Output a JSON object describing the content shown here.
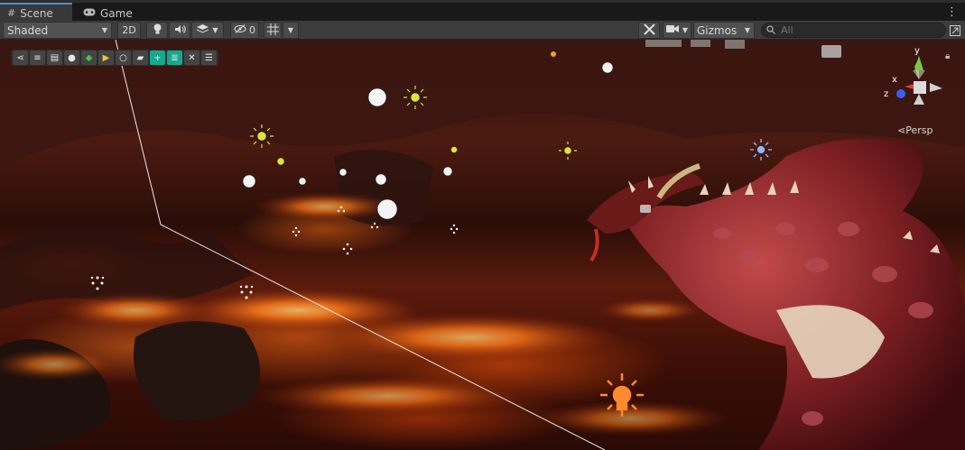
{
  "tabs": [
    {
      "label": "Scene",
      "icon": "grid-icon"
    },
    {
      "label": "Game",
      "icon": "gamepad-icon"
    }
  ],
  "toolbar": {
    "shading_mode": "Shaded",
    "two_d_label": "2D",
    "hidden_count": "0",
    "gizmos_label": "Gizmos",
    "search_placeholder": "All"
  },
  "scene": {
    "projection_label": "Persp",
    "axis_labels": {
      "x": "x",
      "y": "y",
      "z": "z"
    },
    "icon_toolbar": [
      "share-icon",
      "stack-icon",
      "layers-icon",
      "person-icon",
      "diamond-icon",
      "tag-icon",
      "circle-icon",
      "camera-icon",
      "plus-box-icon",
      "list-icon",
      "close-icon",
      "menu-icon"
    ],
    "colors": {
      "accent": "#4d8dd8",
      "teal": "#16a88f",
      "axis_x": "#e33",
      "axis_y": "#7c3",
      "axis_z": "#36f"
    }
  }
}
